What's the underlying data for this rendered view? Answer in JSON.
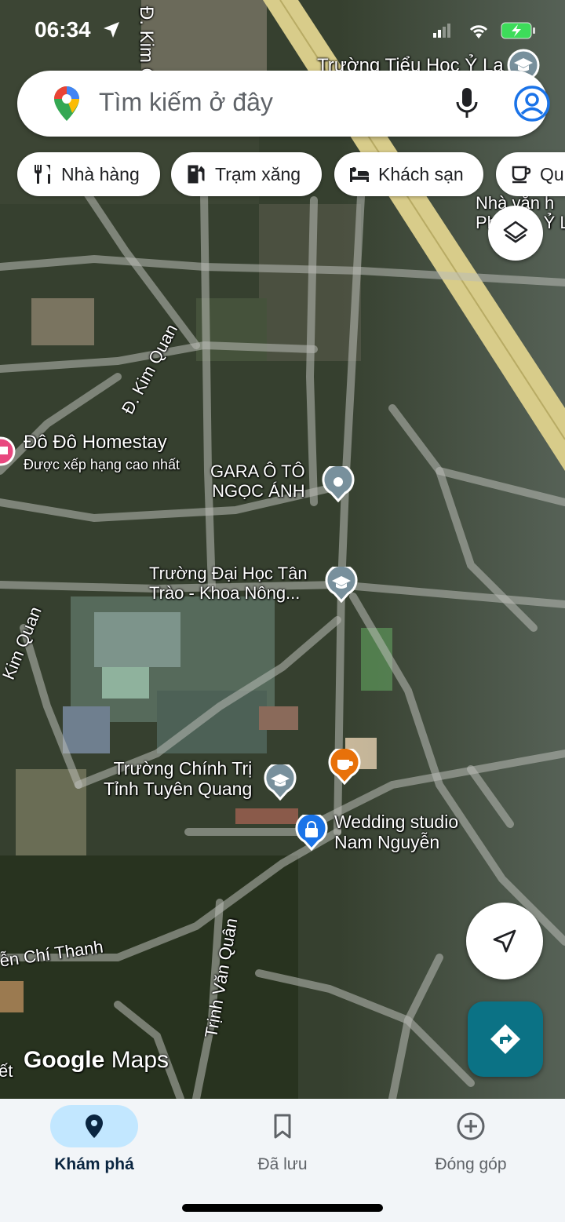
{
  "status_bar": {
    "time": "06:34"
  },
  "search": {
    "placeholder": "Tìm kiếm ở đây"
  },
  "chips": [
    {
      "label": "Nhà hàng",
      "icon": "restaurant-icon"
    },
    {
      "label": "Trạm xăng",
      "icon": "gas-station-icon"
    },
    {
      "label": "Khách sạn",
      "icon": "hotel-icon"
    },
    {
      "label": "Qu",
      "icon": "coffee-icon"
    }
  ],
  "map": {
    "streets": [
      {
        "label": "Đ. Kim Q"
      },
      {
        "label": "Đ. Kim Quan"
      },
      {
        "label": "Kim Quan"
      },
      {
        "label": "ễn Chí Thanh"
      },
      {
        "label": "Trịnh Văn Quân"
      },
      {
        "label": "ết"
      }
    ],
    "places": [
      {
        "name": "Trường Tiểu Học Ỷ La",
        "icon": "school-icon"
      },
      {
        "name_line1": "Nhà văn h",
        "name_line2": "Phường Ỷ L"
      },
      {
        "name": "Đô Đô Homestay",
        "subtitle": "Được xếp hạng cao nhất",
        "icon": "hotel-icon",
        "color": "#e8487f"
      },
      {
        "name_line1": "GARA Ô TÔ",
        "name_line2": "NGỌC ÁNH",
        "icon": "place-icon",
        "color": "#78909c"
      },
      {
        "name_line1": "Trường Đại Học Tân",
        "name_line2": "Trào - Khoa Nông...",
        "icon": "school-icon",
        "color": "#78909c"
      },
      {
        "name_line1": "Trường Chính Trị",
        "name_line2": "Tỉnh Tuyên Quang",
        "icon": "school-icon",
        "color": "#78909c"
      },
      {
        "name": "",
        "icon": "coffee-icon",
        "color": "#e8710a"
      },
      {
        "name_line1": "Wedding studio",
        "name_line2": "Nam Nguyễn",
        "icon": "shopping-icon",
        "color": "#1a73e8"
      }
    ],
    "watermark": {
      "google": "Google",
      "maps": "Maps"
    }
  },
  "nav": [
    {
      "label": "Khám phá",
      "icon": "explore-pin-icon",
      "active": true
    },
    {
      "label": "Đã lưu",
      "icon": "bookmark-icon",
      "active": false
    },
    {
      "label": "Đóng góp",
      "icon": "add-circle-icon",
      "active": false
    }
  ],
  "colors": {
    "accent_teal": "#0b7285",
    "nav_active_pill": "#c2e7ff",
    "nav_active_text": "#0a2540",
    "nav_inactive_text": "#5f6368"
  }
}
